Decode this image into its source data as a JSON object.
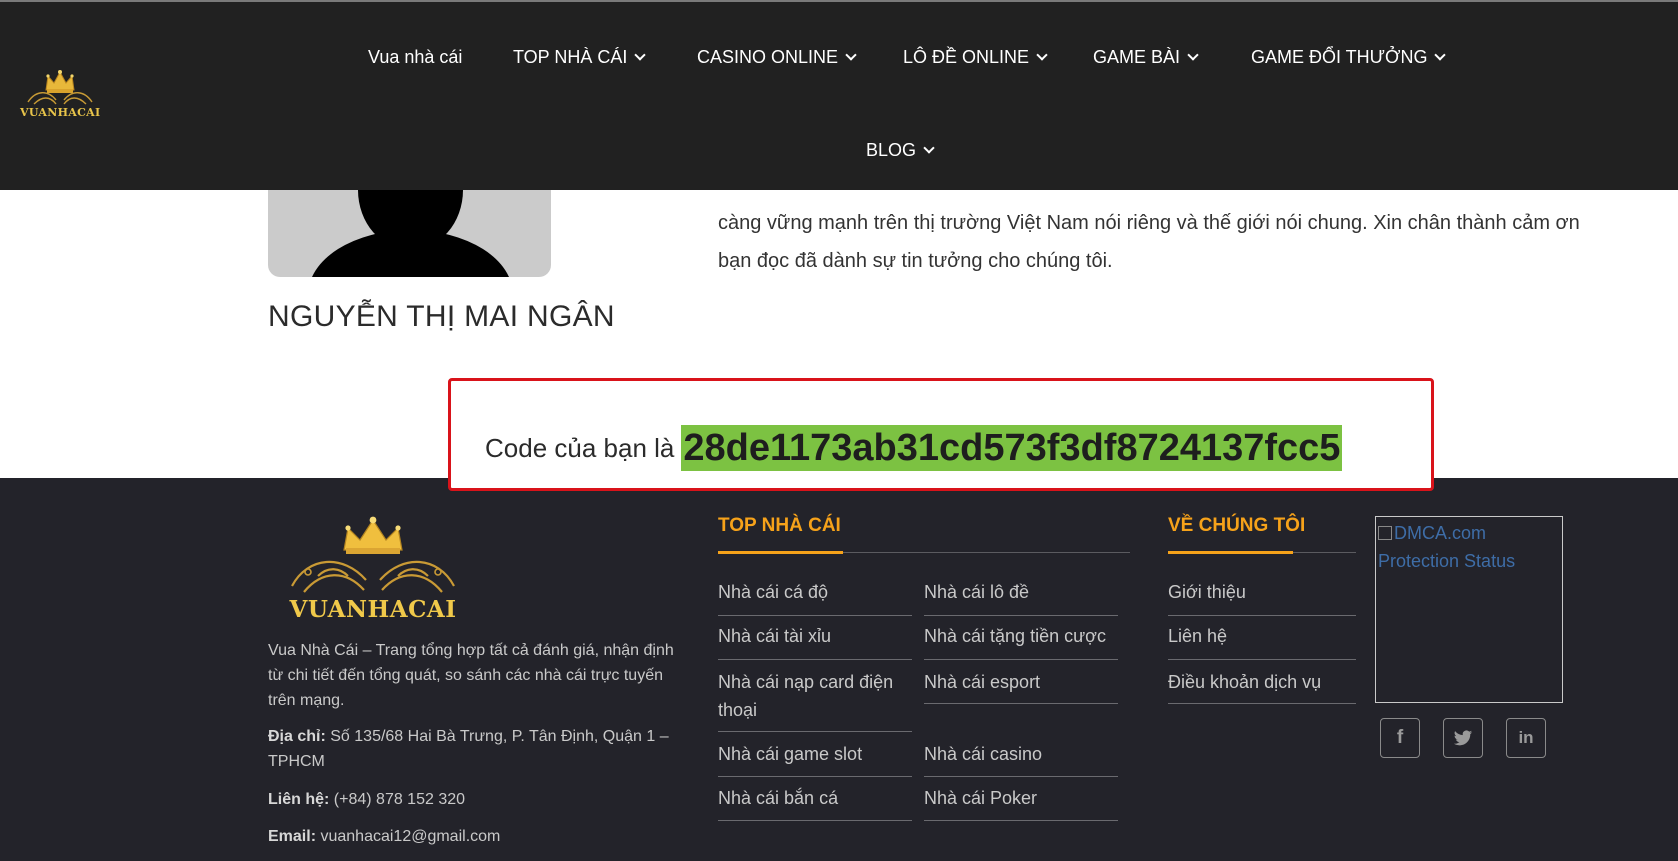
{
  "header": {
    "logo_text": "VUANHACAI",
    "nav": [
      {
        "label": "Vua nhà cái",
        "has_dropdown": false
      },
      {
        "label": "TOP NHÀ CÁI",
        "has_dropdown": true
      },
      {
        "label": "CASINO ONLINE",
        "has_dropdown": true
      },
      {
        "label": "LÔ ĐỀ ONLINE",
        "has_dropdown": true
      },
      {
        "label": "GAME BÀI",
        "has_dropdown": true
      },
      {
        "label": "GAME ĐỔI THƯỞNG",
        "has_dropdown": true
      },
      {
        "label": "BLOG",
        "has_dropdown": true
      }
    ]
  },
  "author": {
    "bio_lines": [
      "càng vững mạnh trên thị trường Việt Nam nói riêng và thế giới nói chung. Xin chân thành cảm ơn",
      "bạn đọc đã dành sự tin tưởng cho chúng tôi."
    ],
    "name": "NGUYỄN THỊ MAI NGÂN"
  },
  "code": {
    "label": "Code của bạn là",
    "value": "28de1173ab31cd573f3df8724137fcc5",
    "highlight_color": "#7cc242",
    "border_color": "#d9131a"
  },
  "footer": {
    "logo_text": "VUANHACAI",
    "about": "Vua Nhà Cái – Trang tổng hợp tất cả đánh giá, nhận định từ chi tiết đến tổng quát, so sánh các nhà cái trực tuyến trên mạng.",
    "address_label": "Địa chỉ:",
    "address": "Số 135/68 Hai Bà Trưng, P. Tân Định, Quận 1 – TPHCM",
    "phone_label": "Liên hệ:",
    "phone": "(+84) 878 152 320",
    "email_label": "Email:",
    "email": "vuanhacai12@gmail.com",
    "top_title": "TOP NHÀ CÁI",
    "top_links_left": [
      "Nhà cái cá độ",
      "Nhà cái tài xỉu",
      "Nhà cái nạp card điện thoại",
      "Nhà cái game slot",
      "Nhà cái bắn cá"
    ],
    "top_links_right": [
      "Nhà cái lô đề",
      "Nhà cái tặng tiền cược",
      "Nhà cái esport",
      "Nhà cái casino",
      "Nhà cái Poker"
    ],
    "about_title": "VỀ CHÚNG TÔI",
    "about_links": [
      "Giới thiệu",
      "Liên hệ",
      "Điều khoản dịch vụ"
    ],
    "dmca_alt": "DMCA.com Protection Status",
    "social": [
      {
        "icon": "facebook-icon",
        "glyph": "f"
      },
      {
        "icon": "twitter-icon",
        "glyph": "t"
      },
      {
        "icon": "linkedin-icon",
        "glyph": "in"
      }
    ],
    "accent_color": "#f6a21a"
  }
}
